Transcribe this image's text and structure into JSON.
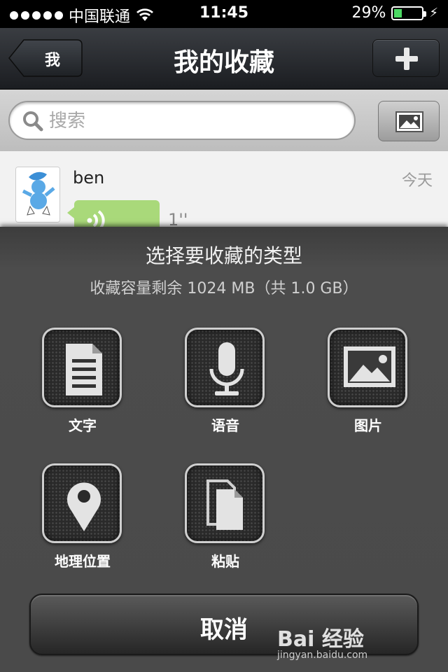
{
  "status_bar": {
    "carrier": "中国联通",
    "time": "11:45",
    "battery_percent": "29%",
    "battery_level": 0.29,
    "battery_color": "#4cd964"
  },
  "nav": {
    "back_label": "我",
    "title": "我的收藏",
    "add_icon": "plus-icon"
  },
  "search": {
    "placeholder": "搜索",
    "value": ""
  },
  "list_items": [
    {
      "name": "ben",
      "time": "今天",
      "type": "voice",
      "duration": "1''",
      "bubble_color": "#a9d97a"
    }
  ],
  "sheet": {
    "title": "选择要收藏的类型",
    "subtitle": "收藏容量剩余 1024 MB（共 1.0 GB）",
    "options": [
      {
        "label": "文字",
        "icon": "document-icon"
      },
      {
        "label": "语音",
        "icon": "microphone-icon"
      },
      {
        "label": "图片",
        "icon": "image-icon"
      },
      {
        "label": "地理位置",
        "icon": "location-pin-icon"
      },
      {
        "label": "粘贴",
        "icon": "paste-icon"
      }
    ],
    "cancel_label": "取消"
  },
  "watermark": {
    "main": "Bai 经验",
    "sub": "jingyan.baidu.com"
  }
}
